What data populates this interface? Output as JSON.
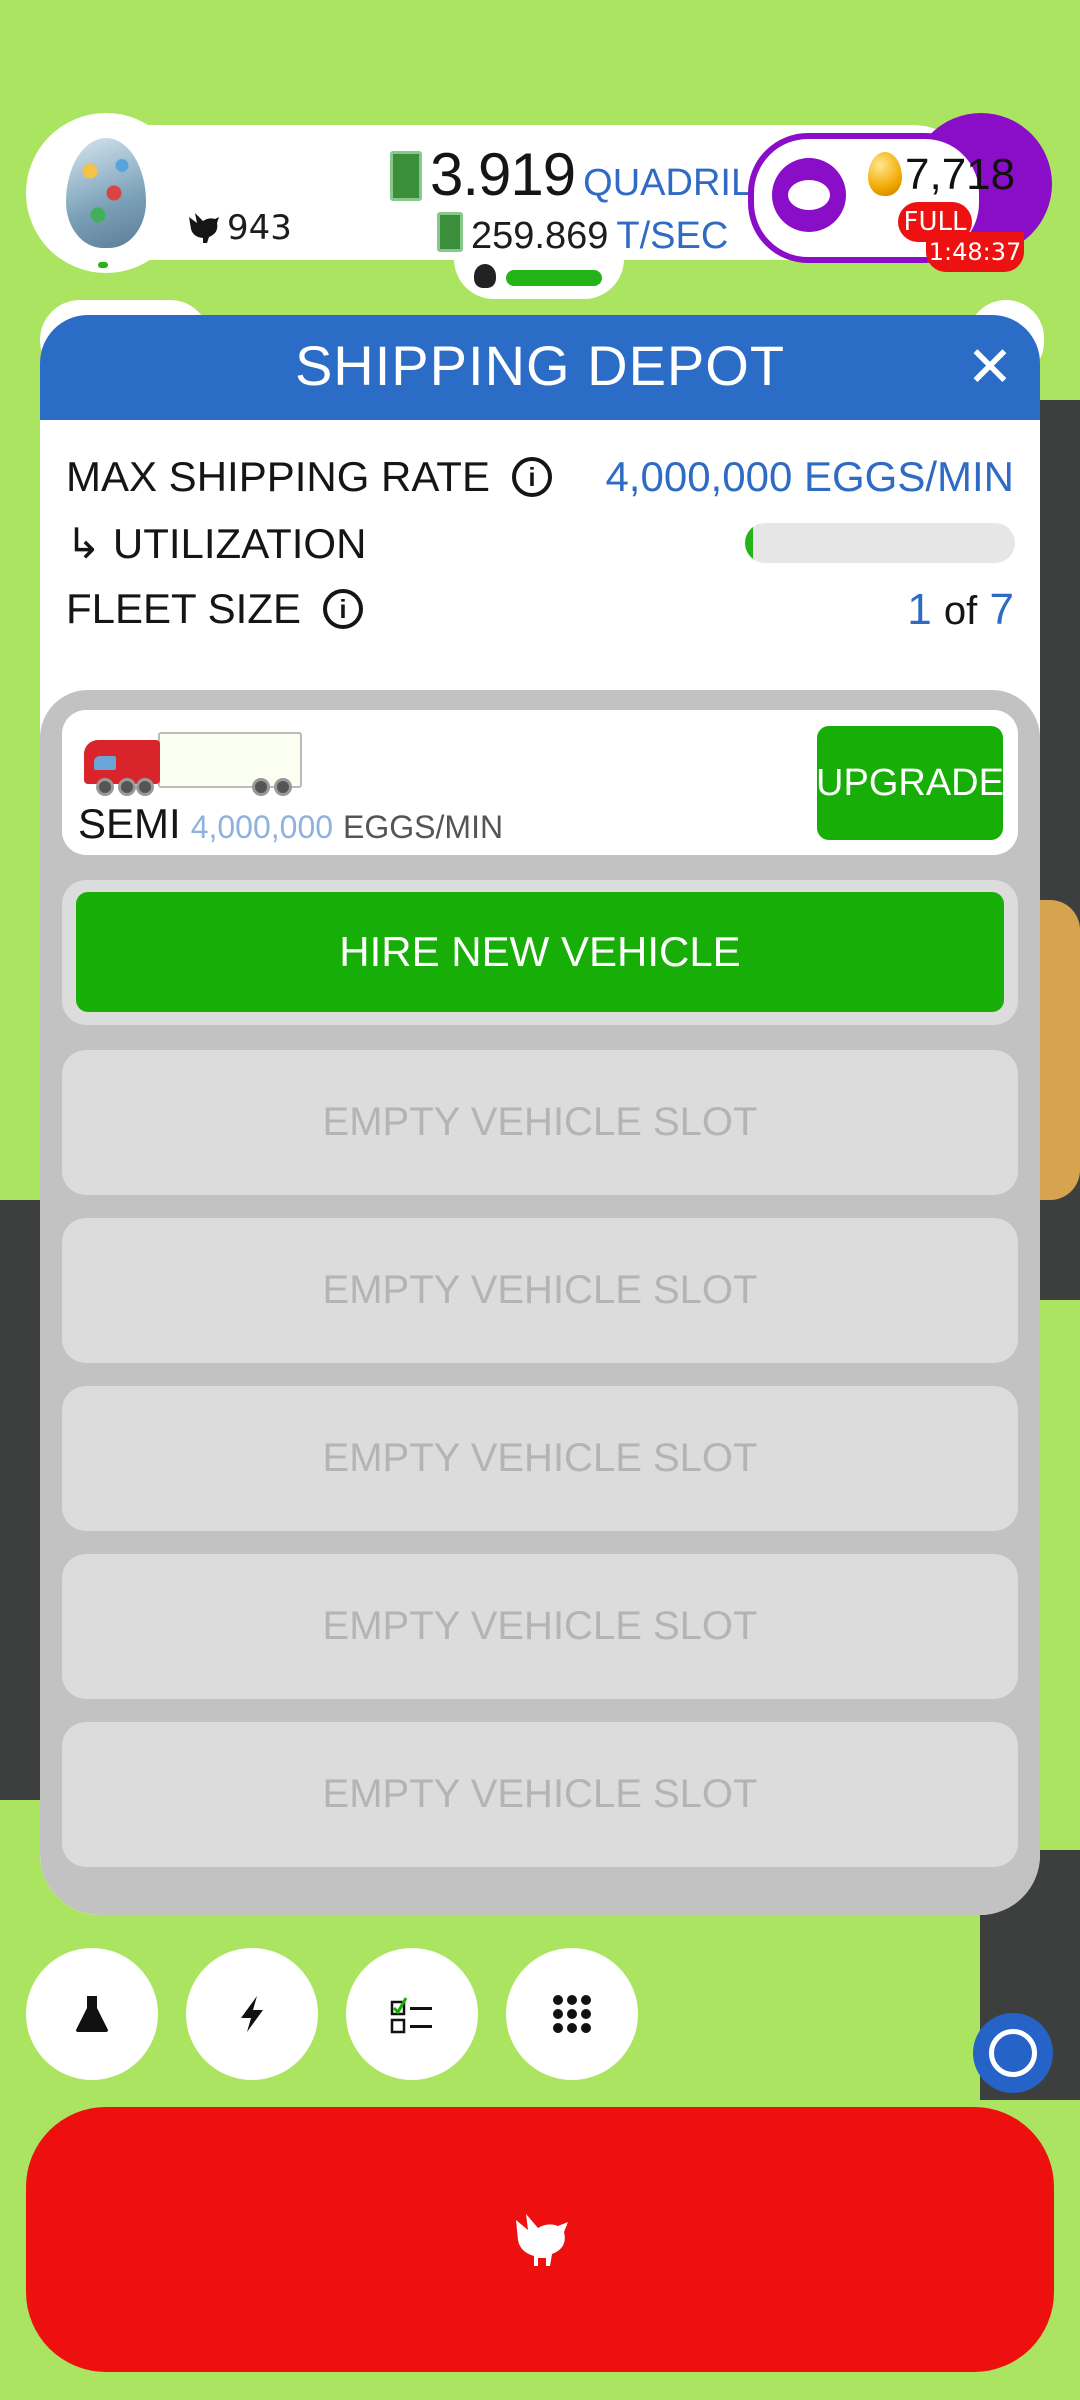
{
  "header": {
    "chicken_count": "943",
    "money_amount": "3.919",
    "money_unit": "QUADRILLION",
    "income_rate": "259.869",
    "income_unit": "T/SEC",
    "golden_eggs": "7,718",
    "silo_status": "FULL",
    "timer": "1:48:37"
  },
  "modal": {
    "title": "SHIPPING DEPOT",
    "close_label": "✕",
    "max_shipping_rate_label": "MAX SHIPPING RATE",
    "max_shipping_rate_value": "4,000,000 EGGS/MIN",
    "utilization_label": "↳ UTILIZATION",
    "utilization_fraction": 0.02,
    "fleet_size_label": "FLEET SIZE",
    "fleet_current": "1",
    "fleet_of": "of",
    "fleet_max": "7",
    "info_icon": "ⓘ"
  },
  "vehicles": [
    {
      "name": "SEMI",
      "rate": "4,000,000",
      "unit": "EGGS/MIN",
      "upgrade_label": "UPGRADE",
      "icon": "semi-truck-icon"
    }
  ],
  "hire_label": "HIRE NEW VEHICLE",
  "empty_slots": [
    "EMPTY VEHICLE SLOT",
    "EMPTY VEHICLE SLOT",
    "EMPTY VEHICLE SLOT",
    "EMPTY VEHICLE SLOT",
    "EMPTY VEHICLE SLOT"
  ],
  "bottom_buttons": [
    {
      "name": "research",
      "icon": "flask-icon"
    },
    {
      "name": "boosts",
      "icon": "lightning-icon"
    },
    {
      "name": "missions",
      "icon": "checklist-icon"
    },
    {
      "name": "menu",
      "icon": "grid-icon"
    }
  ],
  "colors": {
    "background": "#abe461",
    "header_blue": "#2b6dc6",
    "accent_green": "#17ae07",
    "hatch_red": "#ee0f0f",
    "gold_purple": "#8a0dc7",
    "rate_blue": "#2f6bc5"
  }
}
